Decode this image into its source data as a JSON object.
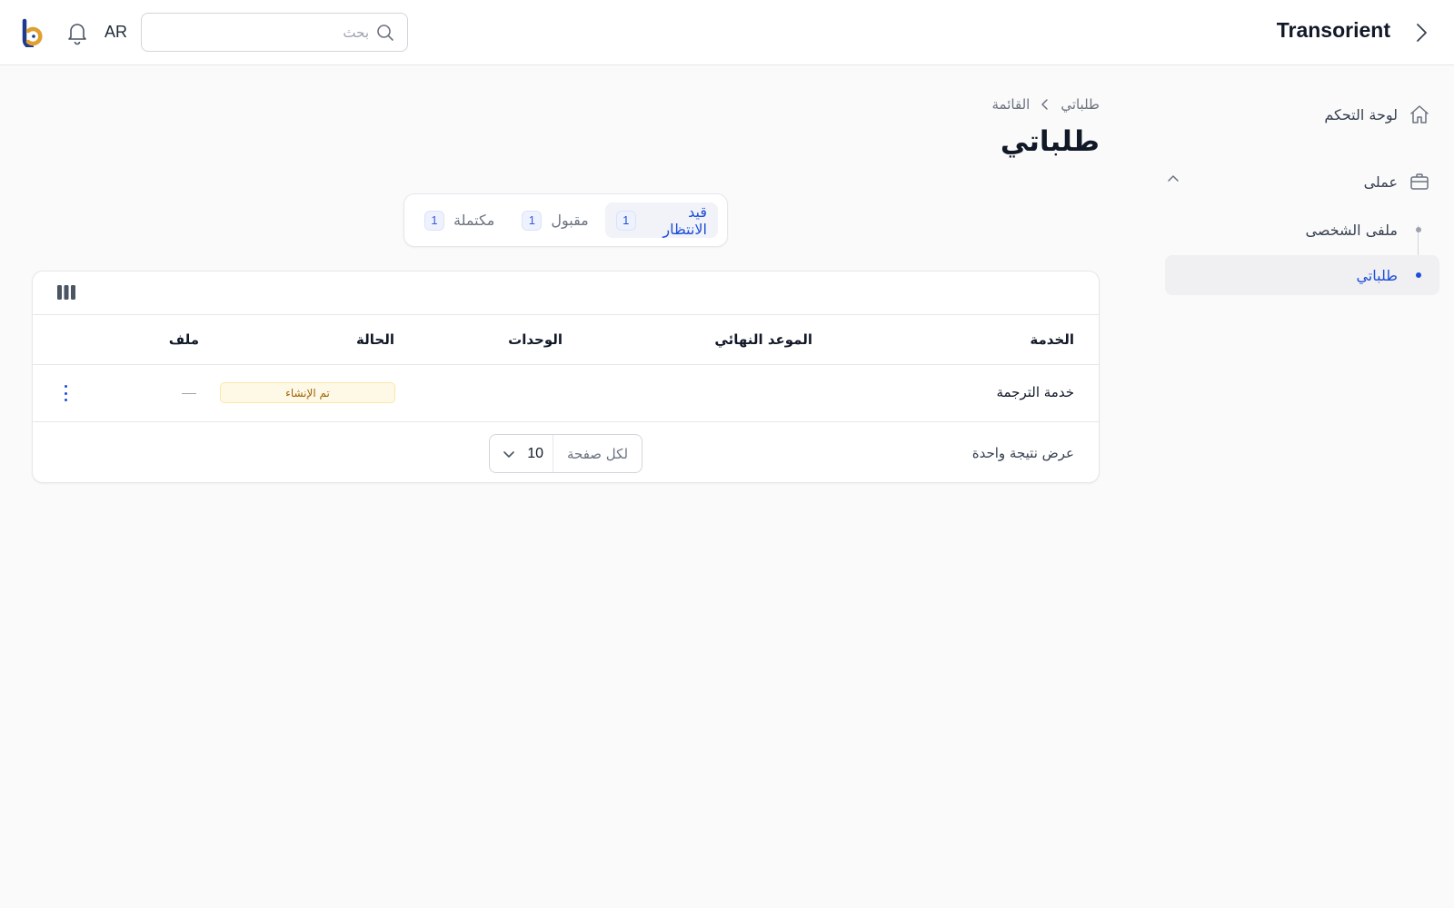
{
  "header": {
    "brand": "Transorient",
    "search_placeholder": "بحث",
    "language": "AR"
  },
  "sidebar": {
    "items": [
      {
        "label": "لوحة التحكم",
        "icon": "home-icon"
      },
      {
        "label": "عملى",
        "icon": "briefcase-icon",
        "expanded": true,
        "children": [
          {
            "label": "ملفى الشخصى",
            "active": false
          },
          {
            "label": "طلباتي",
            "active": true
          }
        ]
      }
    ]
  },
  "breadcrumb": {
    "items": [
      "طلباتي",
      "القائمة"
    ]
  },
  "page": {
    "title": "طلباتي"
  },
  "tabs": [
    {
      "label": "قيد الانتظار",
      "count": "1",
      "active": true
    },
    {
      "label": "مقبول",
      "count": "1",
      "active": false
    },
    {
      "label": "مكتملة",
      "count": "1",
      "active": false
    }
  ],
  "table": {
    "columns": [
      "الخدمة",
      "الموعد النهائي",
      "الوحدات",
      "الحالة",
      "ملف"
    ],
    "rows": [
      {
        "service": "خدمة الترجمة",
        "deadline": "",
        "units": "",
        "status": "تم الإنشاء",
        "file": "—"
      }
    ],
    "results_text": "عرض نتيجة واحدة",
    "per_page_label": "لكل صفحة",
    "per_page_value": "10"
  },
  "colors": {
    "accent": "#1d4ed8",
    "status_bg": "#fef9e7",
    "status_text": "#a16207",
    "logo_blue": "#1e3a8a",
    "logo_orange": "#e0a030"
  }
}
